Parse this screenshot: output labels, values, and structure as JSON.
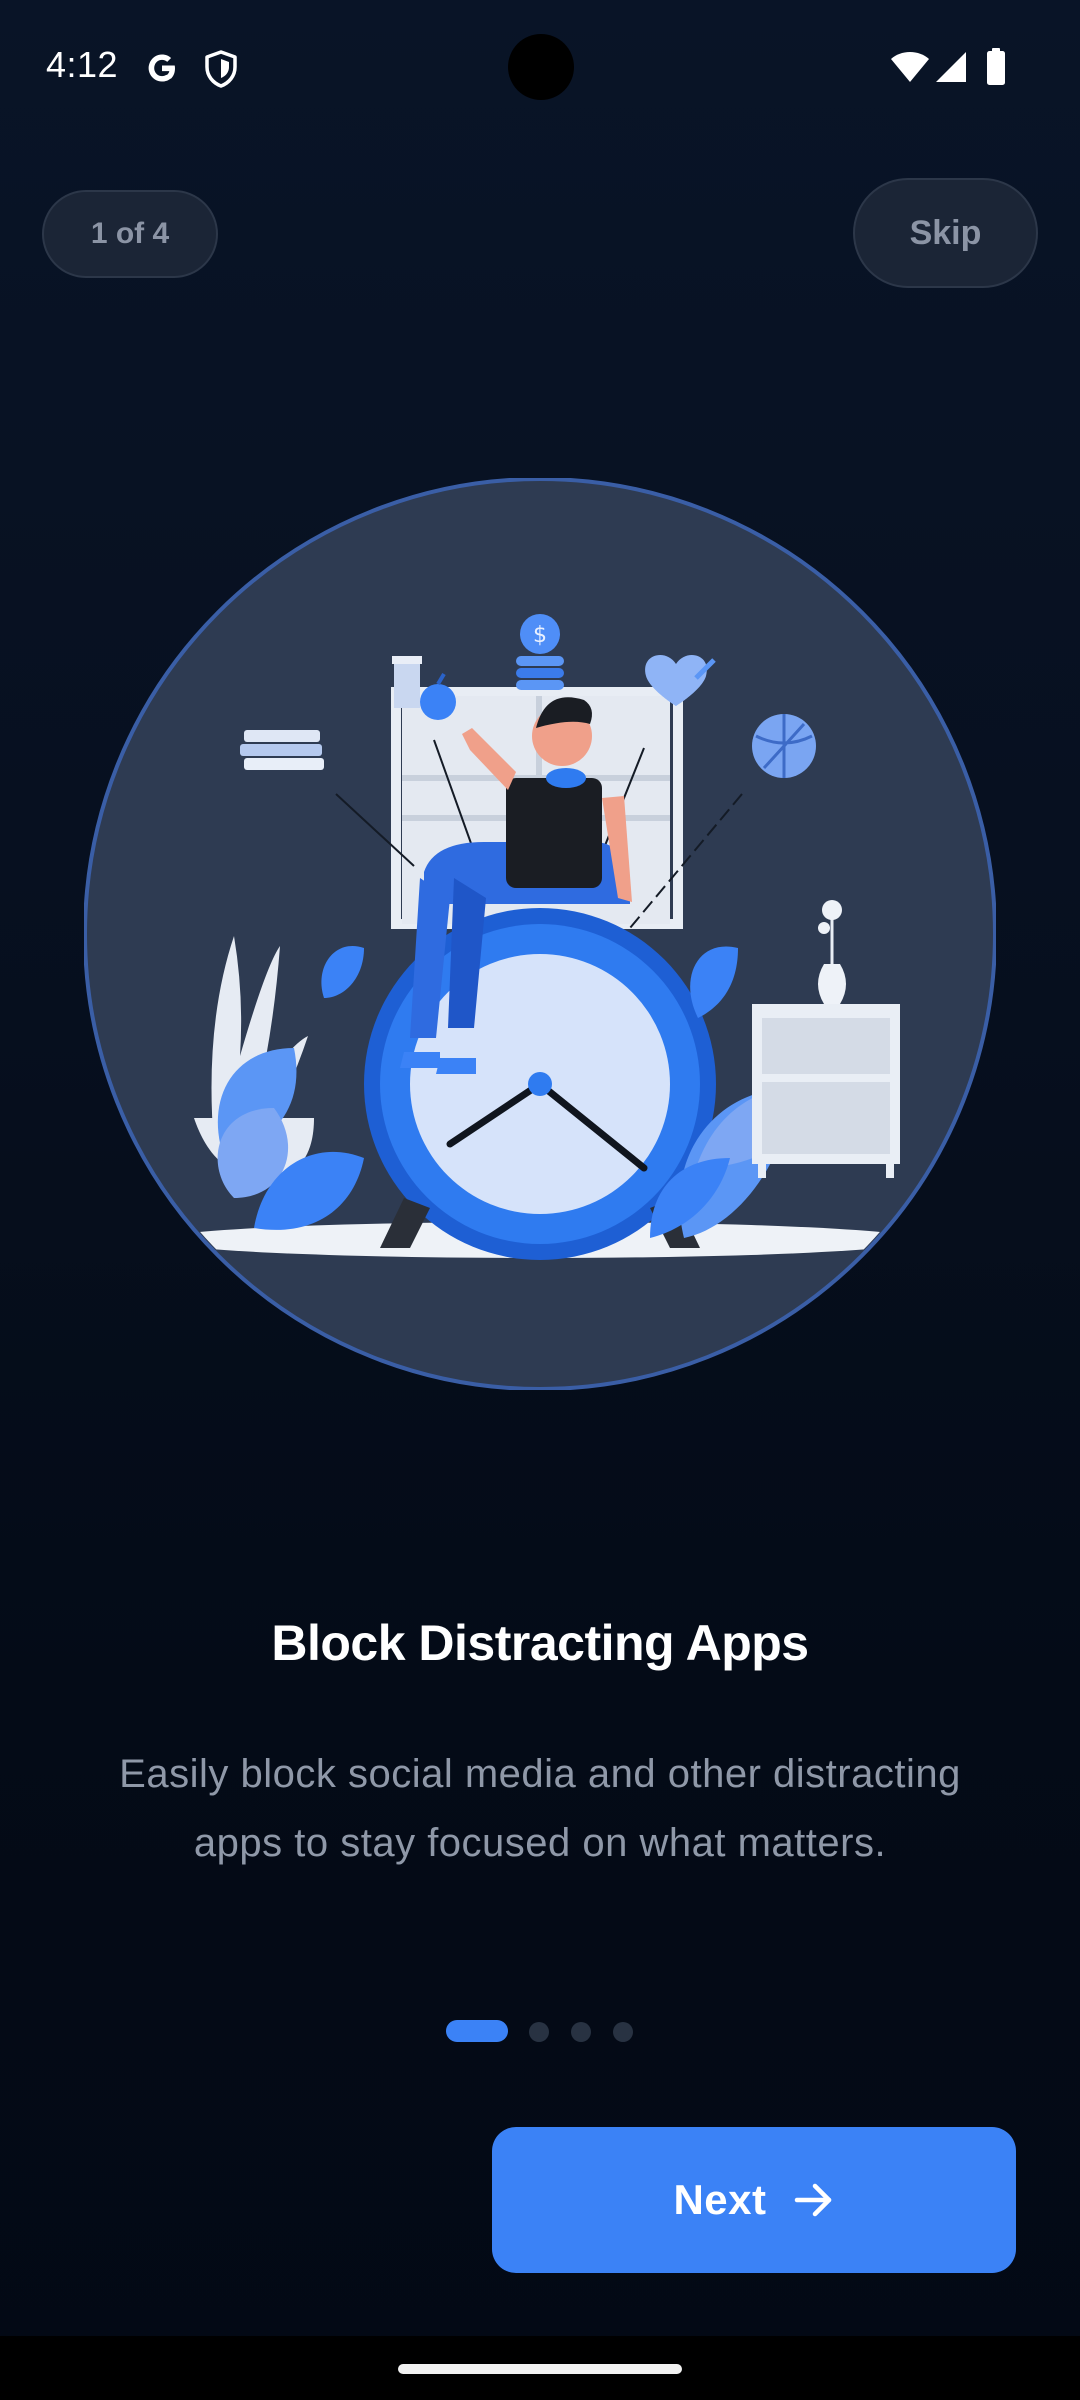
{
  "status_bar": {
    "time": "4:12",
    "left_icons": [
      "google-g-icon",
      "shield-icon"
    ],
    "right_icons": [
      "wifi-icon",
      "cellular-signal-icon",
      "battery-icon"
    ]
  },
  "header": {
    "progress_label": "1 of 4",
    "skip_label": "Skip"
  },
  "illustration": {
    "icon": "person-on-alarm-clock-illustration"
  },
  "content": {
    "title": "Block Distracting Apps",
    "description": "Easily block social media and other distracting apps to stay focused on what matters."
  },
  "pagination": {
    "total": 4,
    "current": 1
  },
  "footer": {
    "next_label": "Next",
    "next_icon": "arrow-right-icon"
  },
  "colors": {
    "background": "#071020",
    "accent": "#3b82f6",
    "pill_background": "#1b2536",
    "muted_text": "#8f98a8"
  }
}
